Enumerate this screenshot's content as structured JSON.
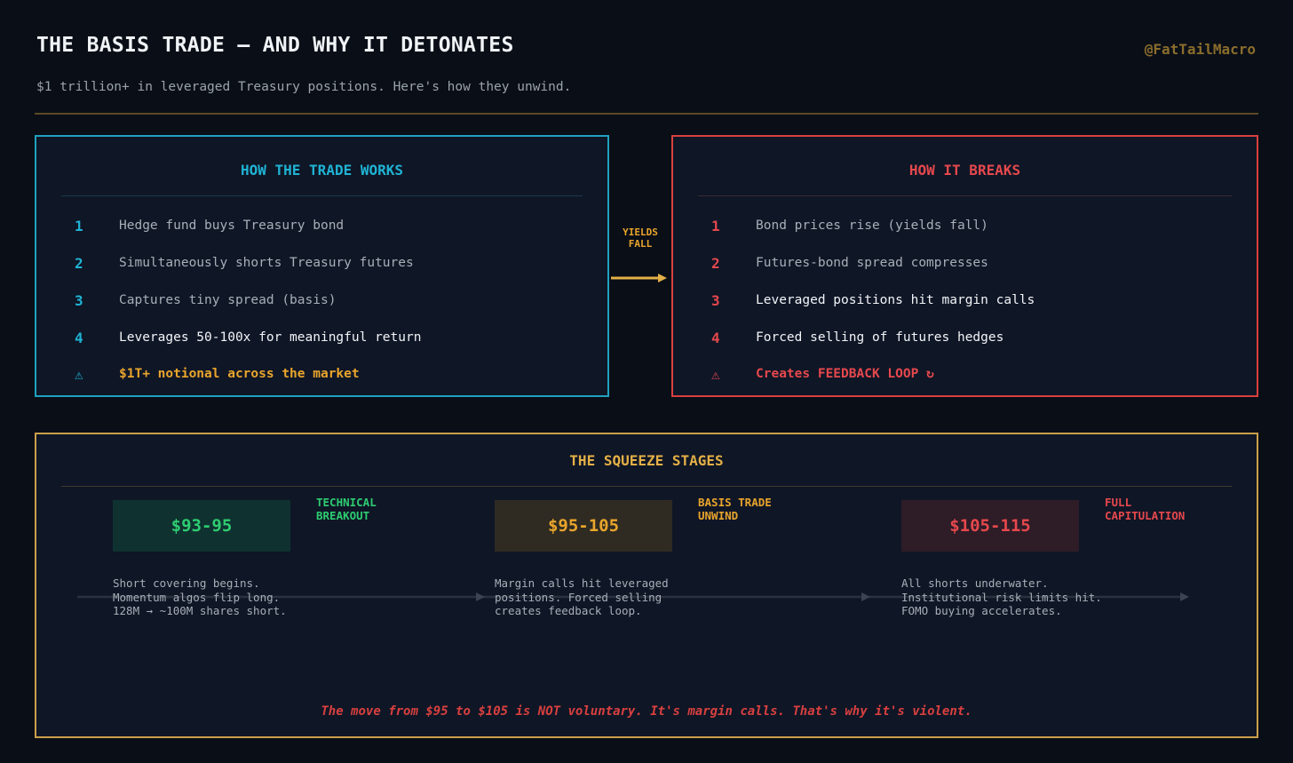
{
  "header": {
    "title": "THE BASIS TRADE — AND WHY IT DETONATES",
    "subtitle": "$1 trillion+ in leveraged Treasury positions. Here's how they unwind.",
    "handle": "@FatTailMacro"
  },
  "works": {
    "title": "HOW THE TRADE WORKS",
    "steps": [
      {
        "num": "1",
        "text": "Hedge fund buys Treasury bond"
      },
      {
        "num": "2",
        "text": "Simultaneously shorts Treasury futures"
      },
      {
        "num": "3",
        "text": "Captures tiny spread (basis)"
      },
      {
        "num": "4",
        "text": "Leverages 50-100x for meaningful return"
      }
    ],
    "warning": {
      "icon": "⚠",
      "text": "$1T+ notional across the market"
    }
  },
  "connector": {
    "line1": "YIELDS",
    "line2": "FALL"
  },
  "breaks": {
    "title": "HOW IT BREAKS",
    "steps": [
      {
        "num": "1",
        "text": "Bond prices rise (yields fall)"
      },
      {
        "num": "2",
        "text": "Futures-bond spread compresses"
      },
      {
        "num": "3",
        "text": "Leveraged positions hit margin calls"
      },
      {
        "num": "4",
        "text": "Forced selling of futures hedges"
      }
    ],
    "warning": {
      "icon": "⚠",
      "text": "Creates FEEDBACK LOOP ↻"
    }
  },
  "squeeze": {
    "title": "THE SQUEEZE STAGES",
    "stages": [
      {
        "price": "$93-95",
        "label_line1": "TECHNICAL",
        "label_line2": "BREAKOUT",
        "desc": [
          "Short covering begins.",
          "Momentum algos flip long.",
          "128M → ~100M shares short."
        ]
      },
      {
        "price": "$95-105",
        "label_line1": "BASIS TRADE",
        "label_line2": "UNWIND",
        "desc": [
          "Margin calls hit leveraged",
          "positions. Forced selling",
          "creates feedback loop."
        ]
      },
      {
        "price": "$105-115",
        "label_line1": "FULL",
        "label_line2": "CAPITULATION",
        "desc": [
          "All shorts underwater.",
          "Institutional risk limits hit.",
          "FOMO buying accelerates."
        ]
      }
    ],
    "note": "The move from $95 to $105 is NOT voluntary. It's margin calls. That's why it's violent."
  },
  "colors": {
    "background": "#0a0e17",
    "cyan": "#1fb3d4",
    "red": "#e5484d",
    "amber": "#e9a52c",
    "green": "#2ecc71",
    "gold_border": "#c9a04a"
  }
}
